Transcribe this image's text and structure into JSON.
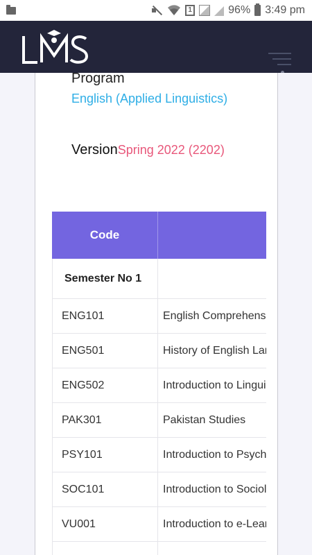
{
  "status_bar": {
    "battery_percent": "96%",
    "time": "3:49 pm",
    "sim_label": "1"
  },
  "header": {
    "logo_text": "LMS"
  },
  "program": {
    "label": "Program",
    "value": "English (Applied Linguistics)"
  },
  "version": {
    "label": "Version",
    "value": "Spring 2022 (2202)"
  },
  "table": {
    "headers": [
      "Code",
      ""
    ],
    "semester_label": "Semester No 1",
    "rows": [
      {
        "code": "ENG101",
        "title": "English Comprehension"
      },
      {
        "code": "ENG501",
        "title": "History of English Language"
      },
      {
        "code": "ENG502",
        "title": "Introduction to Linguistics"
      },
      {
        "code": "PAK301",
        "title": "Pakistan Studies"
      },
      {
        "code": "PSY101",
        "title": "Introduction to Psychology"
      },
      {
        "code": "SOC101",
        "title": "Introduction to Sociology"
      },
      {
        "code": "VU001",
        "title": "Introduction to e-Learning"
      }
    ]
  },
  "colors": {
    "header_bg": "#23253a",
    "table_header_bg": "#7365e0",
    "program_value": "#2eaee6",
    "version_value": "#e8577a"
  }
}
